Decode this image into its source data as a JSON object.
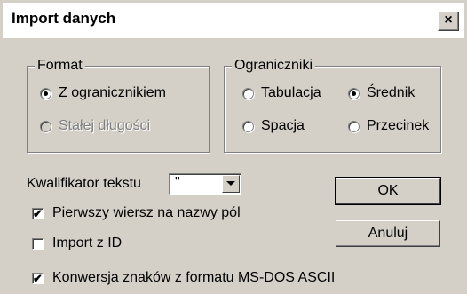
{
  "window": {
    "title": "Import danych",
    "close_glyph": "×"
  },
  "format_group": {
    "legend": "Format",
    "options": [
      {
        "label": "Z ogranicznikiem",
        "checked": true,
        "disabled": false
      },
      {
        "label": "Stałej długości",
        "checked": false,
        "disabled": true
      }
    ]
  },
  "delimiters_group": {
    "legend": "Ograniczniki",
    "options": [
      {
        "label": "Tabulacja",
        "checked": false
      },
      {
        "label": "Średnik",
        "checked": true
      },
      {
        "label": "Spacja",
        "checked": false
      },
      {
        "label": "Przecinek",
        "checked": false
      }
    ]
  },
  "text_qualifier": {
    "label": "Kwalifikator tekstu",
    "value": "\""
  },
  "checkboxes": [
    {
      "label": "Pierwszy wiersz na nazwy pól",
      "checked": true,
      "mark": "✔"
    },
    {
      "label": "Import z ID",
      "checked": false,
      "mark": ""
    },
    {
      "label": "Konwersja znaków z formatu MS-DOS ASCII",
      "checked": true,
      "mark": "✔"
    }
  ],
  "buttons": {
    "ok": "OK",
    "cancel": "Anuluj"
  }
}
